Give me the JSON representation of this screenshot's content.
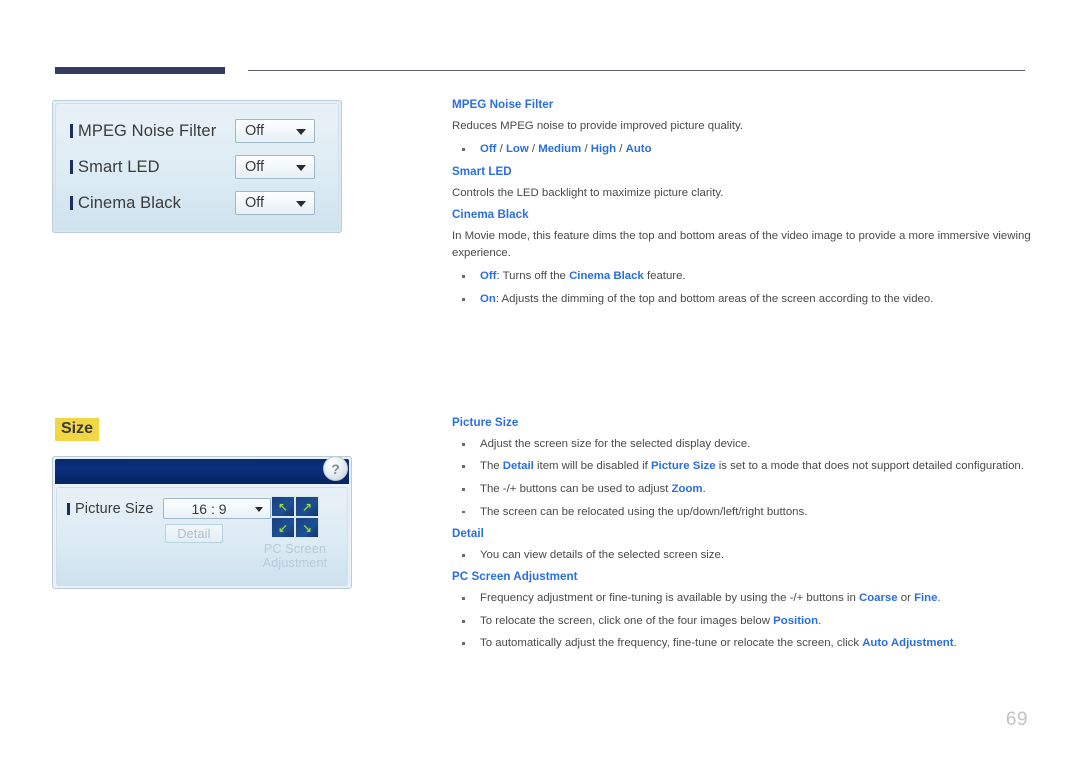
{
  "page": {
    "number": "69"
  },
  "screenshot_picture_options": {
    "rows": [
      {
        "label": "MPEG Noise Filter",
        "value": "Off"
      },
      {
        "label": "Smart LED",
        "value": "Off"
      },
      {
        "label": "Cinema Black",
        "value": "Off"
      }
    ]
  },
  "size_section": {
    "heading": "Size"
  },
  "screenshot_picture_size": {
    "help_glyph": "?",
    "row_label": "Picture Size",
    "row_value": "16 : 9",
    "detail_button": "Detail",
    "pc_adjustment_label_line1": "PC Screen",
    "pc_adjustment_label_line2": "Adjustment",
    "grid_arrows": [
      "↖",
      "↗",
      "↙",
      "↘"
    ]
  },
  "content": {
    "mpeg_noise_filter": {
      "title": "MPEG Noise Filter",
      "paragraph": "Reduces MPEG noise to provide improved picture quality.",
      "options_line": {
        "prefix": "",
        "parts": [
          "Off",
          "Low",
          "Medium",
          "High",
          "Auto"
        ],
        "separator": " / "
      }
    },
    "smart_led": {
      "title": "Smart LED",
      "paragraph": "Controls the LED backlight to maximize picture clarity."
    },
    "cinema_black": {
      "title": "Cinema Black",
      "paragraph": "In Movie mode, this feature dims the top and bottom areas of the video image to provide a more immersive viewing experience.",
      "bullets": [
        {
          "lead": "Off",
          "text_a": ": Turns off the ",
          "emph": "Cinema Black",
          "text_b": " feature."
        },
        {
          "lead": "On",
          "text_a": ": Adjusts the dimming of the top and bottom areas of the screen according to the video.",
          "emph": "",
          "text_b": ""
        }
      ]
    },
    "picture_size": {
      "title": "Picture Size",
      "bullets": [
        {
          "seg1": "Adjust the screen size for the selected display device.",
          "b1": "",
          "seg2": "",
          "b2": "",
          "seg3": ""
        },
        {
          "seg1": "The ",
          "b1": "Detail",
          "seg2": " item will be disabled if ",
          "b2": "Picture Size",
          "seg3": " is set to a mode that does not support detailed configuration."
        },
        {
          "seg1": "The -/+ buttons can be used to adjust ",
          "b1": "Zoom",
          "seg2": ".",
          "b2": "",
          "seg3": ""
        },
        {
          "seg1": "The screen can be relocated using the up/down/left/right buttons.",
          "b1": "",
          "seg2": "",
          "b2": "",
          "seg3": ""
        }
      ]
    },
    "detail": {
      "title": "Detail",
      "bullets": [
        {
          "seg1": "You can view details of the selected screen size.",
          "b1": "",
          "seg2": "",
          "b2": "",
          "seg3": ""
        }
      ]
    },
    "pc_screen_adjustment": {
      "title": "PC Screen Adjustment",
      "bullets": [
        {
          "seg1": "Frequency adjustment or fine-tuning is available by using the -/+ buttons in ",
          "b1": "Coarse",
          "seg2": " or ",
          "b2": "Fine",
          "seg3": "."
        },
        {
          "seg1": "To relocate the screen, click one of the four images below ",
          "b1": "Position",
          "seg2": ".",
          "b2": "",
          "seg3": ""
        },
        {
          "seg1": "To automatically adjust the frequency, fine-tune or relocate the screen, click ",
          "b1": "Auto Adjustment",
          "seg2": ".",
          "b2": "",
          "seg3": ""
        }
      ]
    }
  },
  "colors": {
    "accent_blue": "#2a6fe0",
    "header_bar": "#363a5e",
    "highlight_yellow": "#f2d744",
    "panel_titlebar": "#0b2f7d"
  }
}
